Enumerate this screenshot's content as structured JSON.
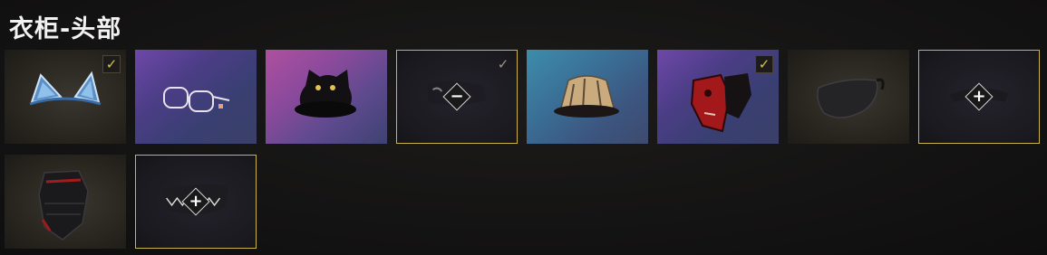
{
  "title": "衣柜-头部",
  "colors": {
    "accent": "#d6c24a",
    "background": "#141313"
  },
  "badges": {
    "add": "+",
    "remove": "−",
    "check": "✓"
  },
  "items": [
    {
      "name": "cat-ear-headband",
      "bg": "dark",
      "state": "equipped"
    },
    {
      "name": "round-glasses",
      "bg": "purple",
      "state": "none"
    },
    {
      "name": "black-cat-hat",
      "bg": "pink",
      "state": "none"
    },
    {
      "name": "dark-mask-selected",
      "bg": "dark",
      "state": "selected-remove"
    },
    {
      "name": "bucket-hat",
      "bg": "teal",
      "state": "none"
    },
    {
      "name": "red-demon-mask",
      "bg": "purple",
      "state": "equipped"
    },
    {
      "name": "black-face-mask",
      "bg": "dark",
      "state": "none"
    },
    {
      "name": "visor-cap",
      "bg": "dark",
      "state": "selected-add"
    },
    {
      "name": "black-red-face-guard",
      "bg": "dark",
      "state": "none"
    },
    {
      "name": "shark-teeth-mask",
      "bg": "dark",
      "state": "selected-add"
    }
  ]
}
